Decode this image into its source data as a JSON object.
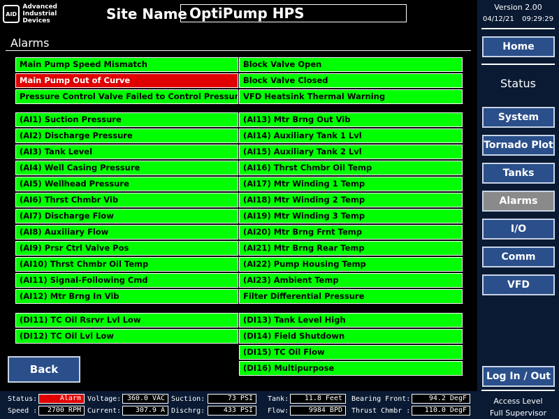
{
  "header": {
    "logo_mark": "AID",
    "logo_line1": "Advanced",
    "logo_line2": "Industrial",
    "logo_line3": "Devices",
    "site_label": "Site Name",
    "site_name": "OptiPump HPS",
    "version": "Version 2.00",
    "date": "04/12/21",
    "time": "09:29:29"
  },
  "nav": {
    "home": "Home",
    "status_title": "Status",
    "system": "System",
    "tornado": "Tornado Plot",
    "tanks": "Tanks",
    "alarms": "Alarms",
    "io": "I/O",
    "comm": "Comm",
    "vfd": "VFD",
    "login": "Log In / Out",
    "access_label": "Access Level",
    "access_value": "Full Supervisor"
  },
  "alarms": {
    "title": "Alarms",
    "group1_left": [
      "Main Pump Speed Mismatch",
      "Main Pump Out of Curve",
      "Pressure Control Valve Failed to Control Pressure"
    ],
    "group1_right": [
      "Block Valve Open",
      "Block Valve Closed",
      "VFD Heatsink Thermal Warning"
    ],
    "group2_left": [
      "(AI1) Suction Pressure",
      "(AI2) Discharge Pressure",
      "(AI3) Tank Level",
      "(AI4) Well Casing Pressure",
      "(AI5) Wellhead Pressure",
      "(AI6) Thrst Chmbr Vib",
      "(AI7) Discharge Flow",
      "(AI8) Auxiliary Flow",
      "(AI9) Prsr Ctrl Valve Pos",
      "(AI10) Thrst Chmbr Oil Temp",
      "(AI11) Signal-Following Cmd",
      "(AI12) Mtr Brng In Vib"
    ],
    "group2_right": [
      "(AI13) Mtr Brng Out Vib",
      "(AI14) Auxiliary Tank 1 Lvl",
      "(AI15) Auxiliary Tank 2 Lvl",
      "(AI16) Thrst Chmbr Oil Temp",
      "(AI17) Mtr Winding 1 Temp",
      "(AI18) Mtr Winding 2 Temp",
      "(AI19) Mtr Winding 3 Temp",
      "(AI20) Mtr Brng Frnt Temp",
      "(AI21) Mtr Brng Rear Temp",
      "(AI22) Pump Housing Temp",
      "(AI23) Ambient Temp",
      "Filter Differential Pressure"
    ],
    "group3_left": [
      "(DI11) TC Oil Rsrvr Lvl Low",
      "(DI12) TC Oil Lvl Low"
    ],
    "group3_right": [
      "(DI13) Tank Level High",
      "(DI14) Field Shutdown",
      "(DI15) TC Oil Flow",
      "(DI16) Multipurpose"
    ],
    "active_alarm": "Main Pump Out of Curve"
  },
  "back": "Back",
  "statusbar": {
    "status_label": "Status:",
    "status_value": "Alarm",
    "speed_label": "Speed :",
    "speed_value": "2700 RPM",
    "voltage_label": "Voltage:",
    "voltage_value": "360.0 VAC",
    "current_label": "Current:",
    "current_value": "307.9 A",
    "suction_label": "Suction:",
    "suction_value": "73 PSI",
    "dischrg_label": "Dischrg:",
    "dischrg_value": "433 PSI",
    "tank_label": "Tank:",
    "tank_value": "11.8 Feet",
    "flow_label": "Flow:",
    "flow_value": "9984 BPD",
    "bearing_label": "Bearing Front:",
    "bearing_value": "94.2 DegF",
    "thrust_label": "Thrust Chmbr :",
    "thrust_value": "110.0 DegF"
  },
  "colors": {
    "ok": "#00ff00",
    "alarm": "#e00000",
    "nav": "#2a4f8a",
    "panel": "#0a1a33"
  }
}
